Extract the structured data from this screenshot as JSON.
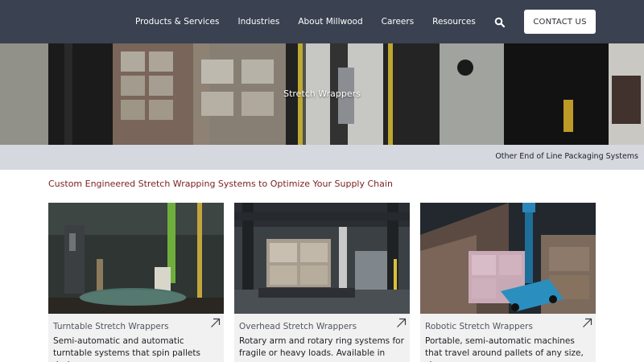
{
  "nav": {
    "items": [
      {
        "label": "Products & Services"
      },
      {
        "label": "Industries"
      },
      {
        "label": "About Millwood"
      },
      {
        "label": "Careers"
      },
      {
        "label": "Resources"
      }
    ],
    "search_icon": "search-icon",
    "contact_label": "CONTACT US"
  },
  "hero": {
    "title": "Stretch Wrappers"
  },
  "subnav": {
    "link_label": "Other End of Line Packaging Systems"
  },
  "section": {
    "title": "Custom Engineered Stretch Wrapping Systems to Optimize Your Supply Chain"
  },
  "cards": [
    {
      "title": "Turntable Stretch Wrappers",
      "description": "Semi-automatic and automatic turntable systems that spin pallets during",
      "icon": "arrow-up-right-icon"
    },
    {
      "title": "Overhead Stretch Wrappers",
      "description": "Rotary arm and rotary ring systems for fragile or heavy loads. Available in",
      "icon": "arrow-up-right-icon"
    },
    {
      "title": "Robotic Stretch Wrappers",
      "description": "Portable, semi-automatic machines that travel around pallets of any size, shape",
      "icon": "arrow-up-right-icon"
    }
  ],
  "colors": {
    "nav_bg": "#3a4150",
    "subnav_bg": "#d6d8df",
    "section_title": "#7a1f1f",
    "card_bg": "#f1f1f1"
  }
}
